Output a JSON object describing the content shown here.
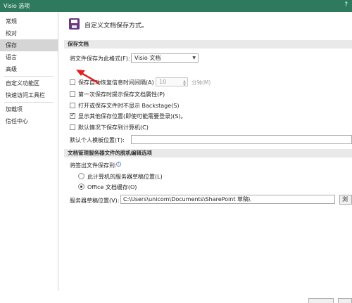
{
  "window": {
    "title": "Visio 选项",
    "help": "?"
  },
  "sidebar": {
    "items": [
      {
        "label": "常规"
      },
      {
        "label": "校对"
      },
      {
        "label": "保存"
      },
      {
        "label": "语言"
      },
      {
        "label": "高级"
      },
      {
        "label": "自定义功能区"
      },
      {
        "label": "快速访问工具栏"
      },
      {
        "label": "加载项"
      },
      {
        "label": "信任中心"
      }
    ],
    "active_index": 2
  },
  "header": {
    "text": "自定义文档保存方式。",
    "icon": "save-icon"
  },
  "save_section": {
    "title": "保存文档",
    "format_label": "将文件保存为此格式(F):",
    "format_value": "Visio 文档",
    "autorecover_label": "保存自动恢复信息时间间隔(A)",
    "autorecover_value": "10",
    "autorecover_unit": "分钟(M)",
    "prompt_props_label": "第一次保存时提示保存文档属性(P)",
    "no_backstage_label": "打开或保存文件时不显示 Backstage(S)",
    "show_other_locations_label": "显示其他保存位置(即使可能需要登录)(S)。",
    "default_local_label": "默认情况下保存到计算机(C)",
    "template_location_label": "默认个人模板位置(T):",
    "template_location_value": ""
  },
  "offline_section": {
    "title": "文档管理服务器文件的脱机编辑选项",
    "save_checkout_label": "将签出文件保存到:",
    "server_drafts_label": "此计算机的服务器草稿位置(L)",
    "office_cache_label": "Office 文档缓存(O)",
    "drafts_location_label": "服务器草稿位置(V):",
    "drafts_location_value": "C:\\Users\\unicom\\Documents\\SharePoint 草稿\\",
    "browse_label": "浏览"
  },
  "states": {
    "autorecover_checked": false,
    "prompt_props_checked": false,
    "no_backstage_checked": false,
    "show_other_locations_checked": true,
    "default_local_checked": false,
    "offline_choice": "office_cache"
  },
  "colors": {
    "titlebar": "#2d7a5f",
    "active_nav": "#d5d5d5",
    "section_band": "#e9e9e9",
    "annotation_arrow": "#e02020"
  }
}
